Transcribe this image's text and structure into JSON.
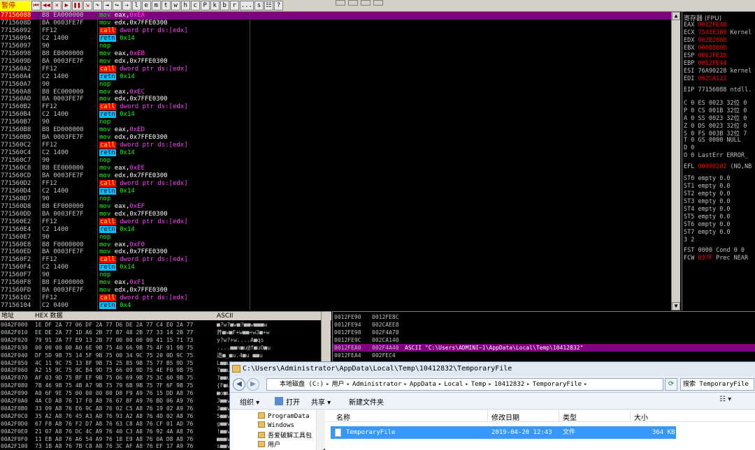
{
  "toolbar": {
    "state": "暂停",
    "buttons": [
      "⏮",
      "◀◀",
      "✕",
      "▶",
      "❚❚",
      "⇲",
      "↷",
      "⇥",
      "↪",
      "⇢",
      "l",
      "e",
      "m",
      "t",
      "w",
      "h",
      "c",
      "P",
      "k",
      "b",
      "r",
      "...",
      "s",
      "☷",
      "?"
    ],
    "menu_tail": [
      "",
      "",
      "",
      ""
    ]
  },
  "disasm": {
    "rows": [
      {
        "addr": "77156088",
        "hex": "B8 EA000000",
        "op": "mov",
        "arg": "eax,",
        "imm": "0xEA",
        "sel": true
      },
      {
        "addr": "7715608D",
        "hex": "BA 0003FE7F",
        "op": "mov",
        "arg": "edx,0x7FFE0300",
        "imm": ""
      },
      {
        "addr": "77156092",
        "hex": "FF12",
        "op": "call",
        "arg": "dword ptr ds:[edx]",
        "kind": "call"
      },
      {
        "addr": "77156094",
        "hex": "C2 1400",
        "op": "retn",
        "arg": "0x14",
        "kind": "retn"
      },
      {
        "addr": "77156097",
        "hex": "90",
        "op": "nop",
        "arg": "",
        "kind": "nop"
      },
      {
        "addr": "77156098",
        "hex": "B8 EB000000",
        "op": "mov",
        "arg": "eax,",
        "imm": "0xEB"
      },
      {
        "addr": "7715609D",
        "hex": "BA 0003FE7F",
        "op": "mov",
        "arg": "edx,0x7FFE0300",
        "imm": ""
      },
      {
        "addr": "771560A2",
        "hex": "FF12",
        "op": "call",
        "arg": "dword ptr ds:[edx]",
        "kind": "call"
      },
      {
        "addr": "771560A4",
        "hex": "C2 1400",
        "op": "retn",
        "arg": "0x14",
        "kind": "retn"
      },
      {
        "addr": "771560A7",
        "hex": "90",
        "op": "nop",
        "arg": "",
        "kind": "nop"
      },
      {
        "addr": "771560A8",
        "hex": "B8 EC000000",
        "op": "mov",
        "arg": "eax,",
        "imm": "0xEC"
      },
      {
        "addr": "771560AD",
        "hex": "BA 0003FE7F",
        "op": "mov",
        "arg": "edx,0x7FFE0300",
        "imm": ""
      },
      {
        "addr": "771560B2",
        "hex": "FF12",
        "op": "call",
        "arg": "dword ptr ds:[edx]",
        "kind": "call"
      },
      {
        "addr": "771560B4",
        "hex": "C2 1400",
        "op": "retn",
        "arg": "0x14",
        "kind": "retn"
      },
      {
        "addr": "771560B7",
        "hex": "90",
        "op": "nop",
        "arg": "",
        "kind": "nop"
      },
      {
        "addr": "771560B8",
        "hex": "B8 ED000000",
        "op": "mov",
        "arg": "eax,",
        "imm": "0xED"
      },
      {
        "addr": "771560BD",
        "hex": "BA 0003FE7F",
        "op": "mov",
        "arg": "edx,0x7FFE0300",
        "imm": ""
      },
      {
        "addr": "771560C2",
        "hex": "FF12",
        "op": "call",
        "arg": "dword ptr ds:[edx]",
        "kind": "call"
      },
      {
        "addr": "771560C4",
        "hex": "C2 1400",
        "op": "retn",
        "arg": "0x14",
        "kind": "retn"
      },
      {
        "addr": "771560C7",
        "hex": "90",
        "op": "nop",
        "arg": "",
        "kind": "nop"
      },
      {
        "addr": "771560C8",
        "hex": "B8 EE000000",
        "op": "mov",
        "arg": "eax,",
        "imm": "0xEE"
      },
      {
        "addr": "771560CD",
        "hex": "BA 0003FE7F",
        "op": "mov",
        "arg": "edx,0x7FFE0300",
        "imm": ""
      },
      {
        "addr": "771560D2",
        "hex": "FF12",
        "op": "call",
        "arg": "dword ptr ds:[edx]",
        "kind": "call"
      },
      {
        "addr": "771560D4",
        "hex": "C2 1400",
        "op": "retn",
        "arg": "0x14",
        "kind": "retn"
      },
      {
        "addr": "771560D7",
        "hex": "90",
        "op": "nop",
        "arg": "",
        "kind": "nop"
      },
      {
        "addr": "771560D8",
        "hex": "B8 EF000000",
        "op": "mov",
        "arg": "eax,",
        "imm": "0xEF"
      },
      {
        "addr": "771560DD",
        "hex": "BA 0003FE7F",
        "op": "mov",
        "arg": "edx,0x7FFE0300",
        "imm": ""
      },
      {
        "addr": "771560E2",
        "hex": "FF12",
        "op": "call",
        "arg": "dword ptr ds:[edx]",
        "kind": "call"
      },
      {
        "addr": "771560E4",
        "hex": "C2 1400",
        "op": "retn",
        "arg": "0x14",
        "kind": "retn"
      },
      {
        "addr": "771560E7",
        "hex": "90",
        "op": "nop",
        "arg": "",
        "kind": "nop"
      },
      {
        "addr": "771560E8",
        "hex": "B8 F0000000",
        "op": "mov",
        "arg": "eax,",
        "imm": "0xF0"
      },
      {
        "addr": "771560ED",
        "hex": "BA 0003FE7F",
        "op": "mov",
        "arg": "edx,0x7FFE0300",
        "imm": ""
      },
      {
        "addr": "771560F2",
        "hex": "FF12",
        "op": "call",
        "arg": "dword ptr ds:[edx]",
        "kind": "call"
      },
      {
        "addr": "771560F4",
        "hex": "C2 1400",
        "op": "retn",
        "arg": "0x14",
        "kind": "retn"
      },
      {
        "addr": "771560F7",
        "hex": "90",
        "op": "nop",
        "arg": "",
        "kind": "nop"
      },
      {
        "addr": "771560F8",
        "hex": "B8 F1000000",
        "op": "mov",
        "arg": "eax,",
        "imm": "0xF1"
      },
      {
        "addr": "771560FD",
        "hex": "BA 0003FE7F",
        "op": "mov",
        "arg": "edx,0x7FFE0300",
        "imm": ""
      },
      {
        "addr": "77156102",
        "hex": "FF12",
        "op": "call",
        "arg": "dword ptr ds:[edx]",
        "kind": "call"
      },
      {
        "addr": "77156104",
        "hex": "C2 0400",
        "op": "retn",
        "arg": "0x4",
        "kind": "retn"
      }
    ]
  },
  "registers": {
    "title": "寄存器 (FPU)",
    "rows": [
      {
        "name": "EAX",
        "val": "0012FE40",
        "rest": ""
      },
      {
        "name": "ECX",
        "val": "7543E3B9",
        "rest": " Kernel"
      },
      {
        "name": "EDX",
        "val": "002B2868",
        "rest": ""
      },
      {
        "name": "EBX",
        "val": "00000000",
        "rest": ""
      },
      {
        "name": "ESP",
        "val": "0012FE28",
        "rest": ""
      },
      {
        "name": "EBP",
        "val": "0012FE44",
        "rest": ""
      },
      {
        "name": "ESI",
        "val": "",
        "rest": "76A90228 kernel"
      },
      {
        "name": "EDI",
        "val": "002CA123",
        "rest": ""
      },
      {
        "name": "EIP",
        "val": "",
        "rest": "77156088 ntdll."
      },
      {
        "name": "C 0",
        "val": "",
        "rest": " ES 0023 32位 0"
      },
      {
        "name": "P 0",
        "val": "",
        "rest": " CS 001B 32位 0"
      },
      {
        "name": "A 0",
        "val": "",
        "rest": " SS 0023 32位 0"
      },
      {
        "name": "Z 0",
        "val": "",
        "rest": " DS 0023 32位 0"
      },
      {
        "name": "S 0",
        "val": "",
        "rest": " FS 003B 32位 7"
      },
      {
        "name": "T 0",
        "val": "",
        "rest": " GS 0000 NULL"
      },
      {
        "name": "D 0",
        "val": "",
        "rest": ""
      },
      {
        "name": "O 0",
        "val": "",
        "rest": " LastErr ERROR_"
      },
      {
        "name": "EFL",
        "val": "00000202",
        "rest": " (NO,NB"
      },
      {
        "name": "ST0",
        "val": "",
        "rest": " empty 0.0"
      },
      {
        "name": "ST1",
        "val": "",
        "rest": " empty 0.0"
      },
      {
        "name": "ST2",
        "val": "",
        "rest": " empty 0.0"
      },
      {
        "name": "ST3",
        "val": "",
        "rest": " empty 0.0"
      },
      {
        "name": "ST4",
        "val": "",
        "rest": " empty 0.0"
      },
      {
        "name": "ST5",
        "val": "",
        "rest": " empty 0.0"
      },
      {
        "name": "ST6",
        "val": "",
        "rest": " empty 0.0"
      },
      {
        "name": "ST7",
        "val": "",
        "rest": " empty 0.0"
      },
      {
        "name": "",
        "val": "",
        "rest": "        3 2"
      },
      {
        "name": "FST",
        "val": "",
        "rest": " 0000  Cond 0 0"
      },
      {
        "name": "FCW",
        "val": "037F",
        "rest": "  Prec NEAR"
      }
    ]
  },
  "dump": {
    "header_addr": "地址",
    "header_hex": "HEX 数据",
    "header_ascii": "ASCII",
    "rows": [
      {
        "a": "00A2F000",
        "h": "1E DF 2A 77 06 DF 2A 77 D6 DE 2A 77 C4 E0 2A 77",
        "s": "■?w?■w■?■■w■■■w"
      },
      {
        "a": "00A2F010",
        "h": "EE DE 2A 77 1D A6 2B 77 87 48 2B 77 33 14 2B 77",
        "s": "荞■w■F+w■■+w3■+w"
      },
      {
        "a": "00A2F020",
        "h": "79 91 2A 77 E9 13 2B 77 00 00 00 00 41 15 71 73",
        "s": "y?w?+w....A■qs"
      },
      {
        "a": "00A2F030",
        "h": "00 00 00 00 A0 6E 9B 75 40 66 9B 75 4F 91 9B 75",
        "s": "....■■n■u@f■uO■u"
      },
      {
        "a": "00A2F040",
        "h": "DF 5D 9B 75 14 5F 9B 75 00 34 9C 75 20 0D 9C 75",
        "s": "遒■_■u.4■u ■■u"
      },
      {
        "a": "00A2F050",
        "h": "4C 11 9C 75 13 8F 9B 75 25 85 9B 75 77 B5 9D 75",
        "s": "L■■u■■■u%■■uw■■u"
      },
      {
        "a": "00A2F060",
        "h": "A2 15 9C 75 9C B4 9D 75 66 09 9D 75 4E F0 9B 75",
        "s": "?■■u■■■uf■■uN■■u"
      },
      {
        "a": "00A2F070",
        "h": "AF 03 9D 75 BF EF 9B 75 06 69 9B 75 3C 60 9B 75",
        "s": "?■■u■■■u■i■u<`■u"
      },
      {
        "a": "00A2F080",
        "h": "7B 46 9B 75 4B A7 9B 75 79 6B 9B 75 7F 6F 9B 75",
        "s": "{F■uK■■uyk■u■o■u"
      },
      {
        "a": "00A2F090",
        "h": "A0 6F 9E 75 00 00 00 00 D8 F9 A9 76 15 DD A8 76",
        "s": "■o■u....■■■v■■■v"
      },
      {
        "a": "00A2F0A0",
        "h": "4A CD A8 76 17 F0 A8 76 67 8F A9 76 BD 06 A9 76",
        "s": "J■■v■■■vg■■v■■■v"
      },
      {
        "a": "00A2F0B0",
        "h": "33 09 A8 76 E6 9C A8 76 02 C5 A8 76 19 02 A9 76",
        "s": "3■■v■■■v■■■v■■■v"
      },
      {
        "a": "00A2F0C0",
        "h": "35 A2 A8 76 45 A3 A8 76 93 A2 A8 76 4D 02 A8 76",
        "s": "5■■vE■■v■■■vM■■v"
      },
      {
        "a": "00A2F0D0",
        "h": "67 F8 A8 76 F2 D7 A8 76 63 C8 A8 76 CF 01 AD 76",
        "s": "g■■v■■■vc■■v■■■v"
      },
      {
        "a": "00A2F0E0",
        "h": "21 07 A8 76 DC 4C A9 76 40 C3 A8 76 92 4A A8 76",
        "s": "!■■v■L■v@■■v■J■v"
      },
      {
        "a": "00A2F0F0",
        "h": "11 EB A8 76 A6 54 A9 76 18 E9 A8 76 0A D8 A8 76",
        "s": "■■■v■T■v■■■v■■■v"
      },
      {
        "a": "00A2F100",
        "h": "73 1B A8 76 7B C8 A8 76 3C AF A8 76 EF 17 A9 76",
        "s": "s■■v{■■v<■■v■■■v"
      }
    ]
  },
  "stack": {
    "rows": [
      {
        "a": "0012FE90",
        "v": "0012FE8C",
        "c": ""
      },
      {
        "a": "0012FE94",
        "v": "002CAEE8",
        "c": ""
      },
      {
        "a": "0012FE98",
        "v": "002F4A78",
        "c": ""
      },
      {
        "a": "0012FE9C",
        "v": "002CA140",
        "c": ""
      },
      {
        "a": "0012FEA0",
        "v": "002F4A40",
        "c": "ASCII \"C:\\Users\\ADMINI~1\\AppData\\Local\\Temp\\10412832\"",
        "sel": true
      },
      {
        "a": "0012FEA4",
        "v": "002FEC4",
        "c": ""
      }
    ]
  },
  "explorer": {
    "title": "C:\\Users\\Administrator\\AppData\\Local\\Temp\\10412832\\TemporaryFile",
    "breadcrumbs": [
      "本地磁盘 (C:)",
      "用户",
      "Administrator",
      "AppData",
      "Local",
      "Temp",
      "10412832",
      "TemporaryFile"
    ],
    "search_placeholder": "搜索 TemporaryFile",
    "commands": {
      "organize": "组织 ▾",
      "open": "打开",
      "share": "共享 ▾",
      "new_folder": "新建文件夹"
    },
    "nav_items": [
      "ProgramData",
      "Windows",
      "吾爱破解工具包",
      "用户"
    ],
    "columns": {
      "name": "名称",
      "date": "修改日期",
      "type": "类型",
      "size": "大小"
    },
    "file": {
      "name": "TemporaryFile",
      "date": "2019-04-20 12:43",
      "type": "文件",
      "size": "364 KB"
    }
  }
}
